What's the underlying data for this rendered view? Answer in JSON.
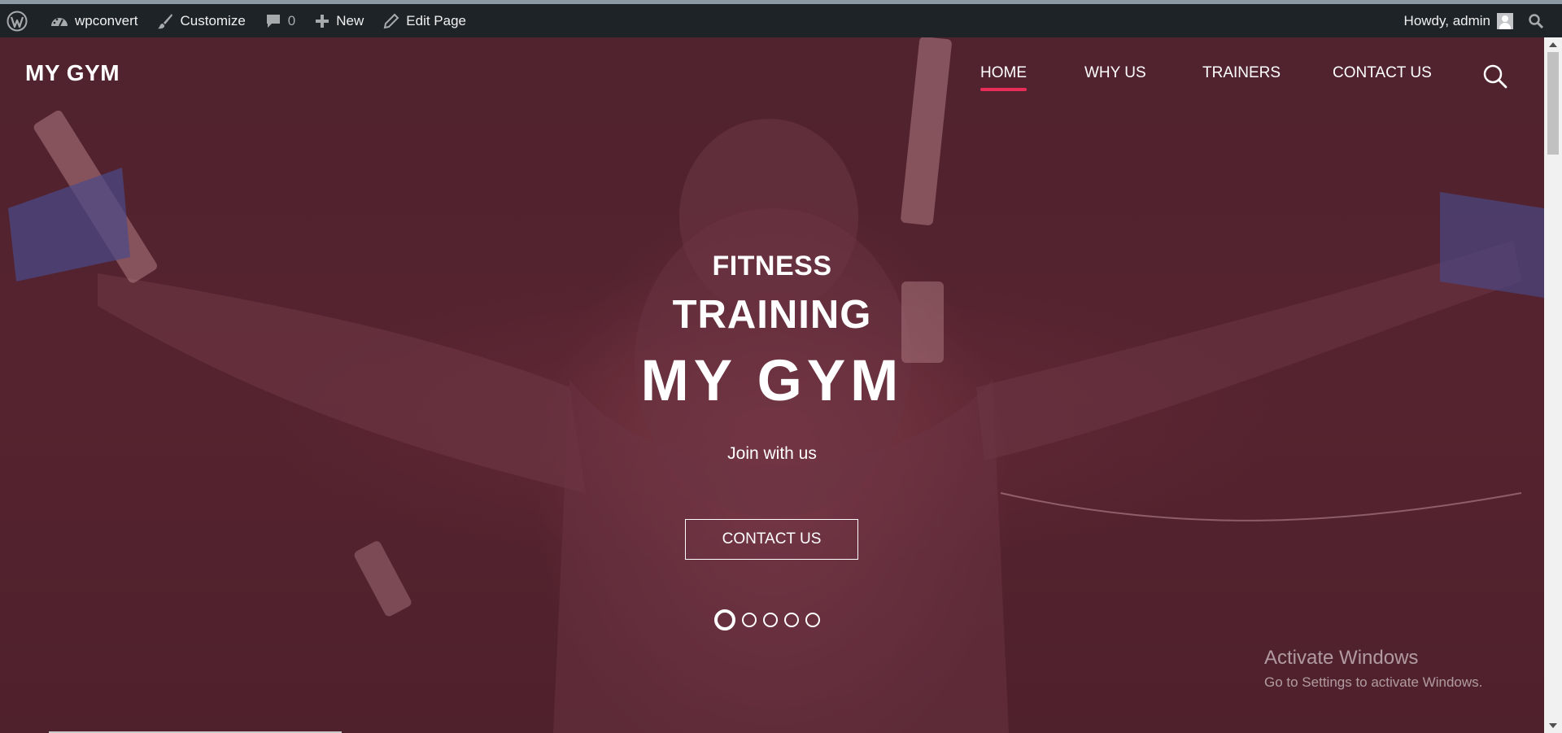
{
  "admin_bar": {
    "site_name": "wpconvert",
    "customize": "Customize",
    "comments_count": "0",
    "new_label": "New",
    "edit_page": "Edit Page",
    "greeting": "Howdy, admin"
  },
  "header": {
    "site_title": "MY GYM",
    "nav": [
      {
        "label": "HOME",
        "active": true
      },
      {
        "label": "WHY US",
        "active": false
      },
      {
        "label": "TRAINERS",
        "active": false
      },
      {
        "label": "CONTACT US",
        "active": false
      }
    ]
  },
  "hero": {
    "line1": "FITNESS",
    "line2": "TRAINING",
    "line3": "MY GYM",
    "tagline": "Join with us",
    "cta_label": "CONTACT US",
    "slide_count": 5,
    "active_slide": 1
  },
  "watermark": {
    "title": "Activate Windows",
    "subtitle": "Go to Settings to activate Windows."
  },
  "colors": {
    "admin_bar_bg": "#1d2327",
    "hero_overlay": "#55232f",
    "nav_active_underline": "#e82d58",
    "text": "#ffffff"
  },
  "icons": {
    "wp_logo": "wordpress-logo-icon",
    "dashboard": "dashboard-icon",
    "customize": "paintbrush-icon",
    "comments": "comment-bubble-icon",
    "new": "plus-icon",
    "edit": "pencil-icon",
    "search": "search-icon"
  }
}
